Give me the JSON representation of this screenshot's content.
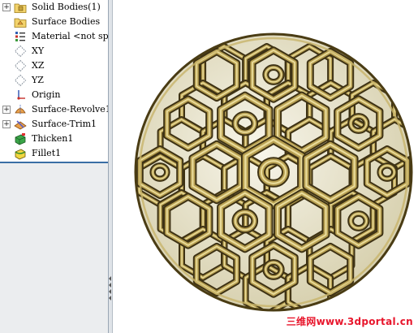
{
  "feature_tree": {
    "items": [
      {
        "label": "Solid Bodies(1)",
        "expander": "+",
        "icon": "solid-bodies-folder-icon"
      },
      {
        "label": "Surface Bodies",
        "expander": "",
        "icon": "surface-bodies-folder-icon"
      },
      {
        "label": "Material <not specif",
        "expander": "",
        "icon": "material-icon"
      },
      {
        "label": "XY",
        "expander": "",
        "icon": "plane-icon"
      },
      {
        "label": "XZ",
        "expander": "",
        "icon": "plane-icon"
      },
      {
        "label": "YZ",
        "expander": "",
        "icon": "plane-icon"
      },
      {
        "label": "Origin",
        "expander": "",
        "icon": "origin-icon"
      },
      {
        "label": "Surface-Revolve1",
        "expander": "+",
        "icon": "surface-revolve-icon"
      },
      {
        "label": "Surface-Trim1",
        "expander": "+",
        "icon": "surface-trim-icon"
      },
      {
        "label": "Thicken1",
        "expander": "",
        "icon": "thicken-icon"
      },
      {
        "label": "Fillet1",
        "expander": "",
        "icon": "fillet-icon"
      }
    ]
  },
  "viewport": {
    "model": "hollow lattice sphere",
    "watermark": "三维网www.3dportal.cn"
  },
  "colors": {
    "gold_light": "#f2e6a8",
    "gold_mid": "#b8a052",
    "gold_dark": "#3e3214",
    "selection_border": "#3a6ea5",
    "watermark": "#e8162c"
  }
}
